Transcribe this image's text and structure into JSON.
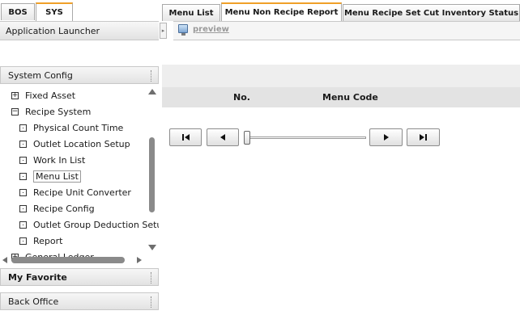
{
  "left_tabs": [
    {
      "label": "BOS",
      "active": false
    },
    {
      "label": "SYS",
      "active": true
    }
  ],
  "app_launcher": "Application Launcher",
  "sections": {
    "system_config": "System Config",
    "my_favorite": "My Favorite",
    "back_office": "Back Office"
  },
  "tree": {
    "fixed_asset": "Fixed Asset",
    "recipe_system": "Recipe System",
    "children": [
      "Physical Count Time",
      "Outlet Location Setup",
      "Work In List",
      "Menu List",
      "Recipe Unit Converter",
      "Recipe Config",
      "Outlet Group Deduction Setu",
      "Report"
    ],
    "partial_next": "General Ledger"
  },
  "right_tabs": [
    {
      "label": "Menu List",
      "active": false
    },
    {
      "label": "Menu Non Recipe Report",
      "active": true
    },
    {
      "label": "Menu Recipe Set Cut Inventory Status",
      "active": false
    }
  ],
  "toolbar": {
    "preview": "preview",
    "icon": "monitor-icon"
  },
  "grid": {
    "columns": [
      "No.",
      "Menu Code"
    ]
  },
  "pager": {
    "first": "first-page-icon",
    "prev": "prev-page-icon",
    "next": "next-page-icon",
    "last": "last-page-icon"
  },
  "colors": {
    "active_tab_accent": "#f0a028"
  }
}
